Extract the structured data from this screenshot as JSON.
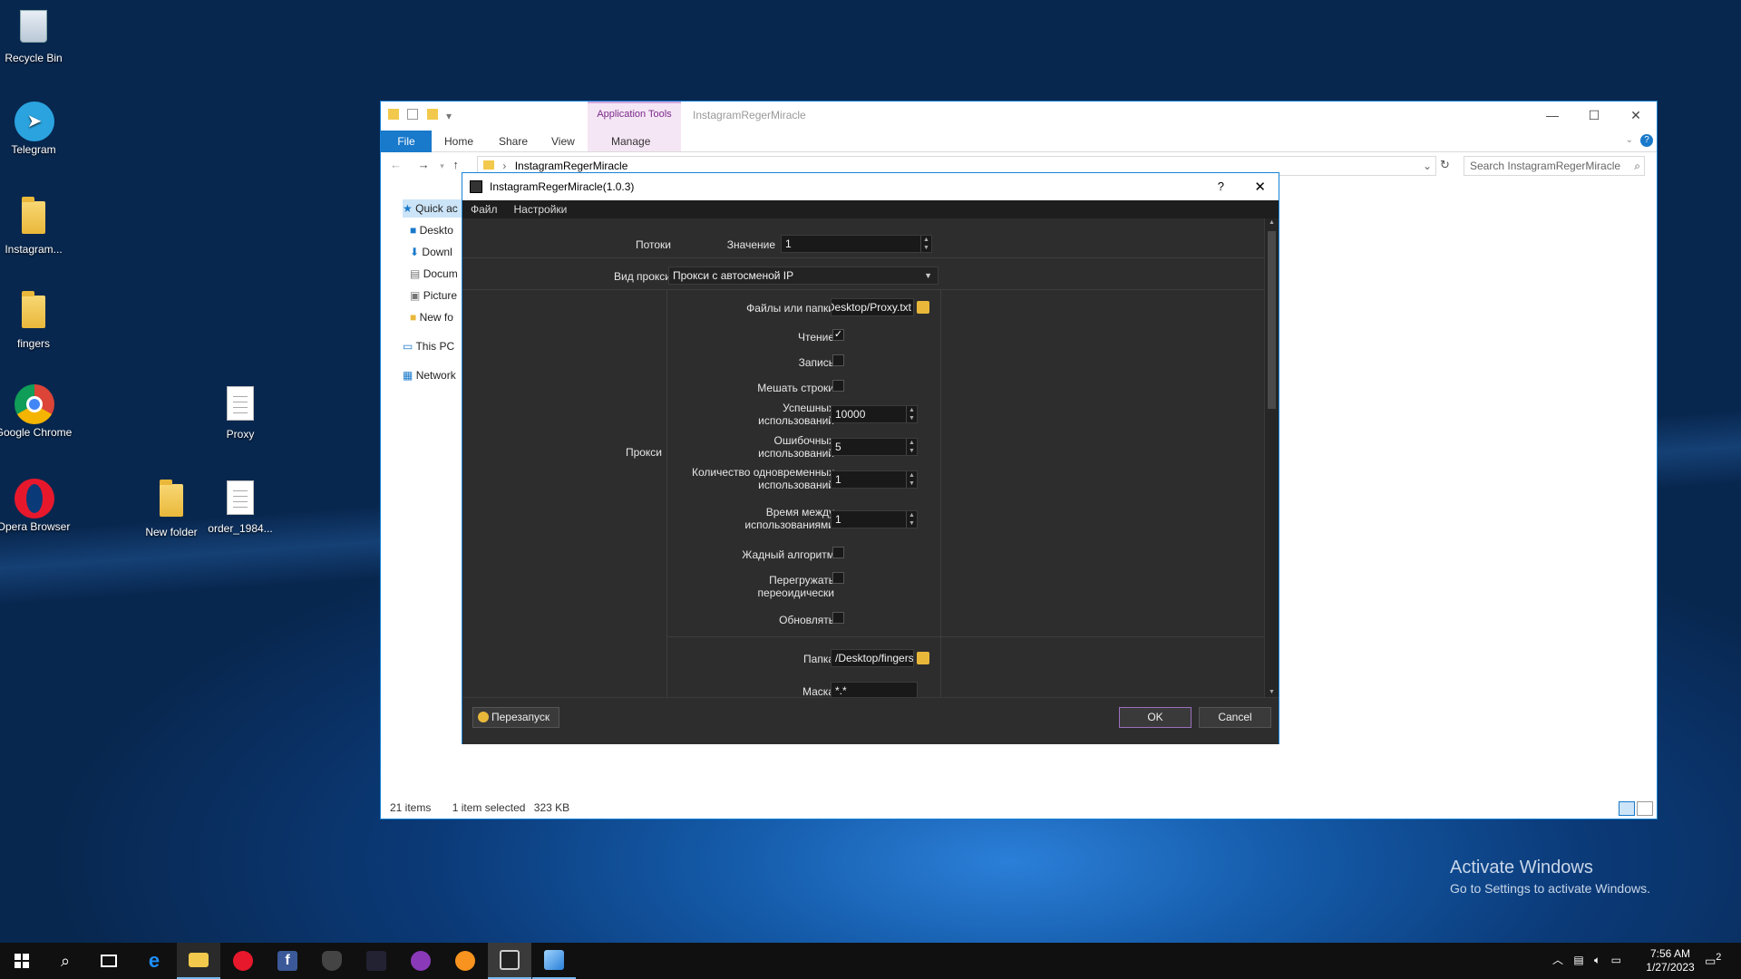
{
  "desktop": {
    "icons": [
      {
        "label": "Recycle Bin"
      },
      {
        "label": "Telegram"
      },
      {
        "label": "Instagram..."
      },
      {
        "label": "fingers"
      },
      {
        "label": "Google Chrome"
      },
      {
        "label": "Opera Browser"
      },
      {
        "label": "Proxy"
      },
      {
        "label": "New folder"
      },
      {
        "label": "order_1984..."
      }
    ],
    "watermark_title": "Activate Windows",
    "watermark_text": "Go to Settings to activate Windows."
  },
  "explorer": {
    "title": "InstagramRegerMiracle",
    "ribbon_context": "Application Tools",
    "tabs": [
      "File",
      "Home",
      "Share",
      "View",
      "Manage"
    ],
    "address": "InstagramRegerMiracle",
    "search_placeholder": "Search InstagramRegerMiracle",
    "nav": [
      "Quick ac",
      "Deskto",
      "Downl",
      "Docum",
      "Picture",
      "New fo",
      "This PC",
      "Network"
    ],
    "status_items": "21 items",
    "status_selected": "1 item selected",
    "status_size": "323 KB"
  },
  "dialog": {
    "title": "InstagramRegerMiracle(1.0.3)",
    "help": "?",
    "close": "✕",
    "menu": [
      "Файл",
      "Настройки"
    ],
    "threads_label": "Потоки",
    "value_label": "Значение",
    "value": "1",
    "proxy_type_label": "Вид прокси",
    "proxy_type_value": "Прокси с автосменой IP",
    "proxy_section_label": "Прокси",
    "files_label": "Файлы или папки",
    "files_value": "Desktop/Proxy.txt",
    "read_label": "Чтение",
    "read_checked": "✓",
    "write_label": "Запись",
    "shuffle_label": "Мешать строки",
    "success_label": "Успешных использований",
    "success_value": "10000",
    "errors_label": "Ошибочных использований",
    "errors_value": "5",
    "concurrent_label": "Количество одновременных использований",
    "concurrent_value": "1",
    "interval_label": "Время между использованиями",
    "interval_value": "1",
    "greedy_label": "Жадный алгоритм",
    "reload_label": "Перегружать переоидически",
    "update_label": "Обновлять",
    "folder_label": "Папка",
    "folder_value": "/Desktop/fingers",
    "mask_label": "Маска",
    "mask_value": "*.*",
    "restart_label": "Перезапуск",
    "ok_label": "OK",
    "cancel_label": "Cancel"
  },
  "taskbar": {
    "time": "7:56 AM",
    "date": "1/27/2023",
    "notifications": "2"
  }
}
